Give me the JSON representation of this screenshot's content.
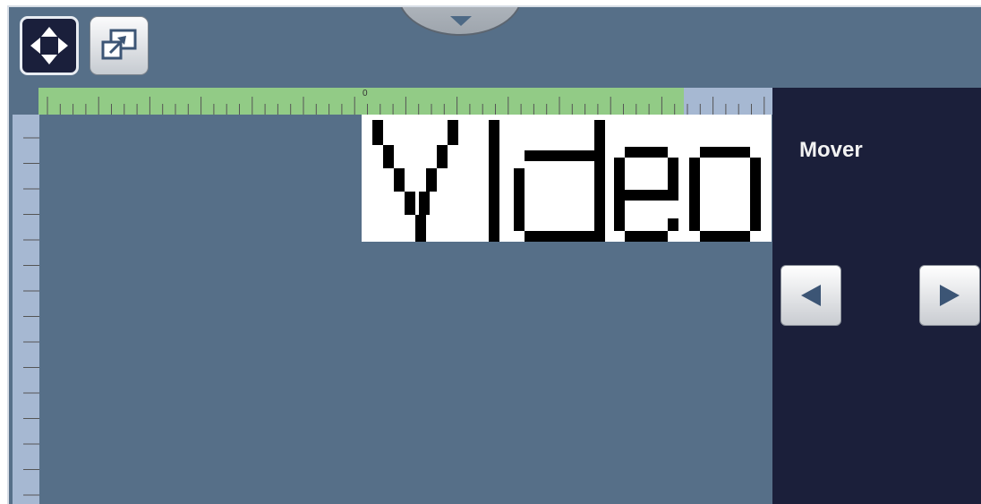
{
  "top_tab": {
    "icon": "chevron-down-icon"
  },
  "toolbar": {
    "move_button": {
      "icon": "move-arrows-icon",
      "selected": true
    },
    "resize_button": {
      "icon": "resize-expand-icon",
      "selected": false
    }
  },
  "ruler": {
    "zero_label": "0"
  },
  "preview": {
    "text": "Video"
  },
  "panel": {
    "title": "Mover",
    "left_button": {
      "icon": "arrow-left-icon"
    },
    "right_button": {
      "icon": "arrow-right-icon"
    }
  },
  "colors": {
    "workspace": "#566f88",
    "panel": "#1b1f3a",
    "ruler": "#a6b8d2",
    "ruler_active": "#92cb86"
  }
}
